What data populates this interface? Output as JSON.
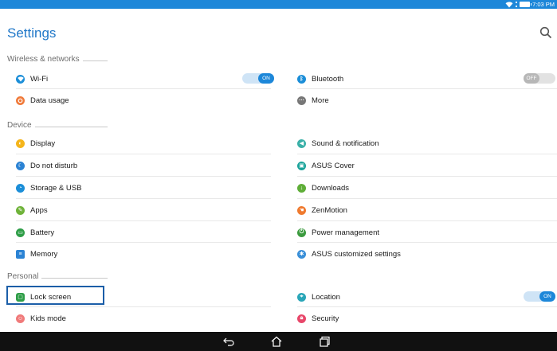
{
  "status_bar": {
    "time": "7:03 PM"
  },
  "app_bar": {
    "title": "Settings"
  },
  "sections": {
    "wireless": "Wireless & networks",
    "device": "Device",
    "personal": "Personal"
  },
  "items": {
    "wifi": "Wi-Fi",
    "data_usage": "Data usage",
    "bluetooth": "Bluetooth",
    "more": "More",
    "display": "Display",
    "do_not_disturb": "Do not disturb",
    "storage": "Storage & USB",
    "apps": "Apps",
    "battery": "Battery",
    "memory": "Memory",
    "sound": "Sound & notification",
    "asus_cover": "ASUS Cover",
    "downloads": "Downloads",
    "zenmotion": "ZenMotion",
    "power": "Power management",
    "asus_custom": "ASUS customized settings",
    "lock_screen": "Lock screen",
    "kids_mode": "Kids mode",
    "location": "Location",
    "security": "Security"
  },
  "toggles": {
    "wifi": "ON",
    "bluetooth": "OFF",
    "location": "ON"
  },
  "colors": {
    "accent": "#1d87d9",
    "highlight_border": "#1b5ea8"
  }
}
